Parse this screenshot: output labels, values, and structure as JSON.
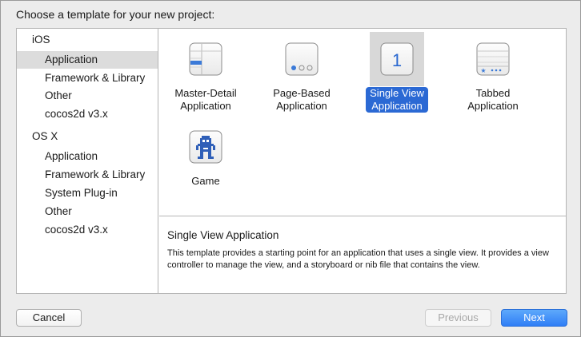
{
  "dialog": {
    "prompt": "Choose a template for your new project:"
  },
  "sidebar": {
    "sections": [
      {
        "header": "iOS",
        "items": [
          "Application",
          "Framework & Library",
          "Other",
          "cocos2d v3.x"
        ]
      },
      {
        "header": "OS X",
        "items": [
          "Application",
          "Framework & Library",
          "System Plug-in",
          "Other",
          "cocos2d v3.x"
        ]
      }
    ],
    "selected": "iOS / Application"
  },
  "templates": [
    {
      "label": "Master-Detail\nApplication",
      "icon": "master-detail-icon"
    },
    {
      "label": "Page-Based\nApplication",
      "icon": "page-based-icon"
    },
    {
      "label": "Single View\nApplication",
      "icon": "single-view-icon",
      "icon_text": "1",
      "selected": true
    },
    {
      "label": "Tabbed\nApplication",
      "icon": "tabbed-icon"
    },
    {
      "label": "Game",
      "icon": "game-icon"
    }
  ],
  "detail": {
    "title": "Single View Application",
    "description": "This template provides a starting point for an application that uses a single view. It provides a view controller to manage the view, and a storyboard or nib file that contains the view."
  },
  "buttons": {
    "cancel": "Cancel",
    "previous": "Previous",
    "next": "Next"
  },
  "colors": {
    "selection_blue": "#2b69d4",
    "primary_button": "#3a86f7"
  }
}
